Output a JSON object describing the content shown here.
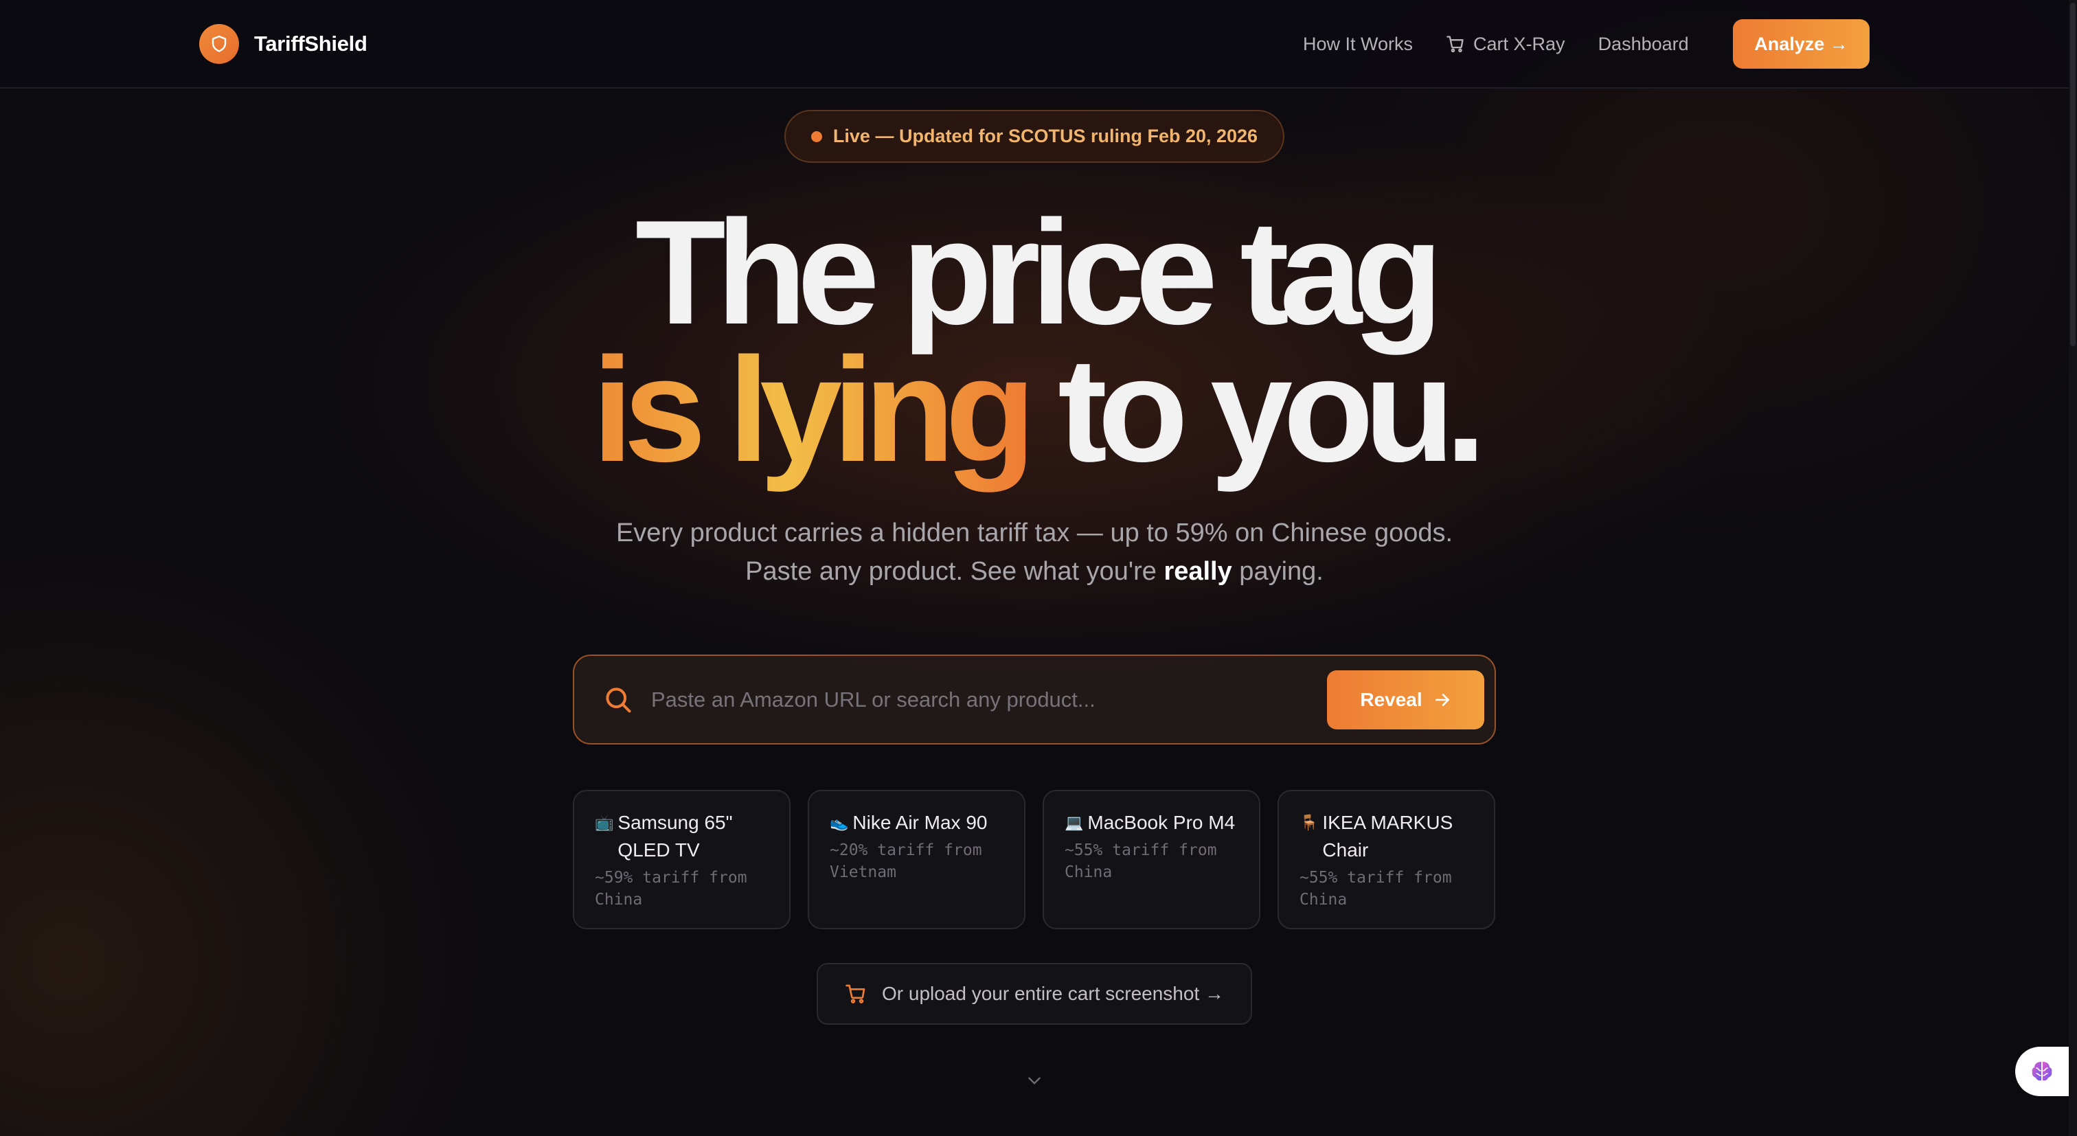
{
  "brand": {
    "name": "TariffShield"
  },
  "nav": {
    "links": [
      "How It Works",
      "Cart X-Ray",
      "Dashboard"
    ],
    "cta": "Analyze →"
  },
  "badge": {
    "text": "Live — Updated for SCOTUS ruling Feb 20, 2026"
  },
  "headline": {
    "line1": "The price tag",
    "line2_highlight": "is lying",
    "line2_rest": "to you."
  },
  "subtitle": {
    "line1": "Every product carries a hidden tariff tax — up to 59% on Chinese goods.",
    "line2_pre": "Paste any product. See what you're ",
    "line2_bold": "really",
    "line2_post": " paying."
  },
  "search": {
    "placeholder": "Paste an Amazon URL or search any product...",
    "button": "Reveal"
  },
  "products": [
    {
      "emoji": "📺",
      "name": "Samsung 65\" QLED TV",
      "detail": "~59% tariff from China"
    },
    {
      "emoji": "👟",
      "name": "Nike Air Max 90",
      "detail": "~20% tariff from Vietnam"
    },
    {
      "emoji": "💻",
      "name": "MacBook Pro M4",
      "detail": "~55% tariff from China"
    },
    {
      "emoji": "🪑",
      "name": "IKEA MARKUS Chair",
      "detail": "~55% tariff from China"
    }
  ],
  "upload": {
    "text": "Or upload your entire cart screenshot →"
  },
  "colors": {
    "accent": "#ee7c33",
    "accent_light": "#f2bd47",
    "background": "#0c0b10"
  },
  "icons": [
    "shield-icon",
    "cart-icon",
    "search-icon",
    "arrow-right-icon",
    "chevron-down-icon",
    "brain-icon"
  ]
}
